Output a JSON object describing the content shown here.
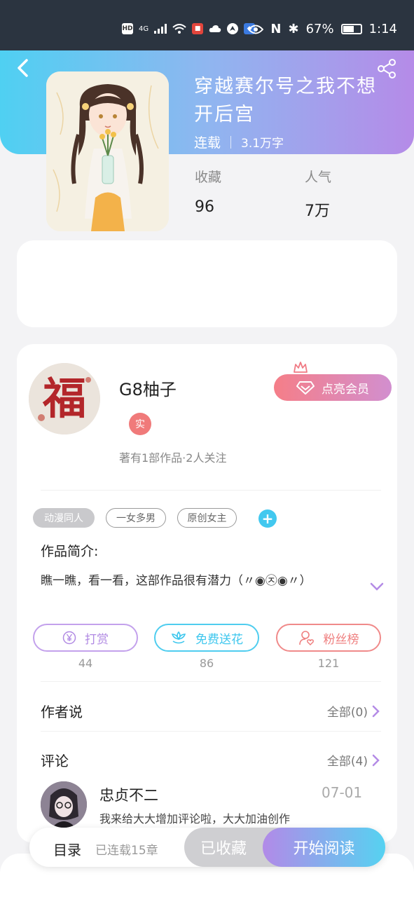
{
  "status_bar": {
    "hd": "HD",
    "network": "4G",
    "nfc": "N",
    "battery": "67%",
    "time": "1:14"
  },
  "book": {
    "title": "穿越赛尔号之我不想开后宫",
    "status": "连载",
    "word_count": "3.1万字",
    "favorites_label": "收藏",
    "favorites_value": "96",
    "popularity_label": "人气",
    "popularity_value": "7万"
  },
  "author": {
    "name": "G8柚子",
    "badge": "实",
    "works_info": "著有1部作品·2人关注",
    "vip_button": "点亮会员"
  },
  "tags": [
    "动漫同人",
    "一女多男",
    "原创女主"
  ],
  "intro": {
    "label": "作品简介:",
    "text": "瞧一瞧，看一看，这部作品很有潜力（〃◉㉨◉〃）"
  },
  "actions": {
    "reward": {
      "label": "打赏",
      "count": "44"
    },
    "flower": {
      "label": "免费送花",
      "count": "86"
    },
    "fans": {
      "label": "粉丝榜",
      "count": "121"
    }
  },
  "author_says": {
    "title": "作者说",
    "all": "全部(0)"
  },
  "comments": {
    "title": "评论",
    "all": "全部(4)",
    "first": {
      "user": "忠贞不二",
      "date": "07-01",
      "text": "我来给大大增加评论啦，大大加油创作"
    }
  },
  "bottom_bar": {
    "toc": "目录",
    "chapters": "已连载15章",
    "favorited": "已收藏",
    "start_reading": "开始阅读"
  },
  "colors": {
    "gradient_start": "#4fd0f2",
    "gradient_end": "#b58be8",
    "reward": "#b18ae3",
    "flower": "#3ec7ee",
    "fans": "#ef7f7f"
  }
}
